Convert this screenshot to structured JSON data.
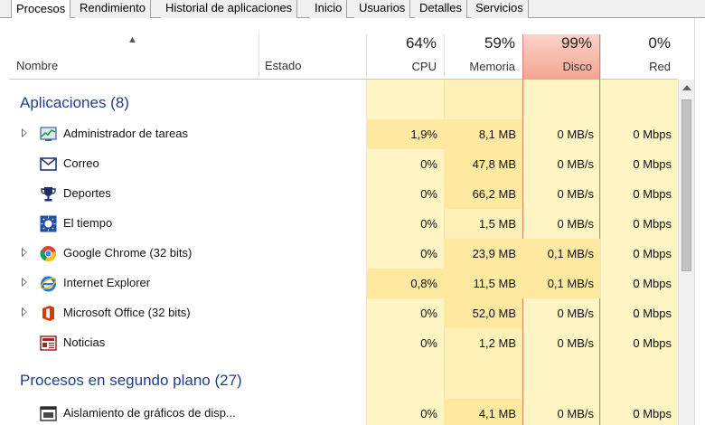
{
  "tabs": [
    "Procesos",
    "Rendimiento",
    "Historial de aplicaciones",
    "Inicio",
    "Usuarios",
    "Detalles",
    "Servicios"
  ],
  "header": {
    "name_label": "Nombre",
    "status_label": "Estado",
    "cpu": {
      "percent": "64%",
      "label": "CPU"
    },
    "memory": {
      "percent": "59%",
      "label": "Memoria"
    },
    "disk": {
      "percent": "99%",
      "label": "Disco"
    },
    "network": {
      "percent": "0%",
      "label": "Red"
    }
  },
  "colors": {
    "usage_light": "#fff4c4",
    "usage_medium": "#ffe9a1",
    "disk_highlight": "#f4a48f",
    "group_title": "#1f3f8a"
  },
  "groups": [
    {
      "title": "Aplicaciones (8)",
      "rows": [
        {
          "name": "Administrador de tareas",
          "icon": "task-manager-icon",
          "expandable": true,
          "cpu": "1,9%",
          "memory": "8,1 MB",
          "disk": "0 MB/s",
          "network": "0 Mbps"
        },
        {
          "name": "Correo",
          "icon": "mail-icon",
          "expandable": false,
          "cpu": "0%",
          "memory": "47,8 MB",
          "disk": "0 MB/s",
          "network": "0 Mbps"
        },
        {
          "name": "Deportes",
          "icon": "trophy-icon",
          "expandable": false,
          "cpu": "0%",
          "memory": "66,2 MB",
          "disk": "0 MB/s",
          "network": "0 Mbps"
        },
        {
          "name": "El tiempo",
          "icon": "weather-sun-icon",
          "expandable": false,
          "cpu": "0%",
          "memory": "1,5 MB",
          "disk": "0 MB/s",
          "network": "0 Mbps"
        },
        {
          "name": "Google Chrome (32 bits)",
          "icon": "chrome-icon",
          "expandable": true,
          "cpu": "0%",
          "memory": "23,9 MB",
          "disk": "0,1 MB/s",
          "network": "0 Mbps"
        },
        {
          "name": "Internet Explorer",
          "icon": "internet-explorer-icon",
          "expandable": true,
          "cpu": "0,8%",
          "memory": "11,5 MB",
          "disk": "0,1 MB/s",
          "network": "0 Mbps"
        },
        {
          "name": "Microsoft Office (32 bits)",
          "icon": "office-icon",
          "expandable": true,
          "cpu": "0%",
          "memory": "52,0 MB",
          "disk": "0 MB/s",
          "network": "0 Mbps"
        },
        {
          "name": "Noticias",
          "icon": "news-icon",
          "expandable": false,
          "cpu": "0%",
          "memory": "1,2 MB",
          "disk": "0 MB/s",
          "network": "0 Mbps"
        }
      ]
    },
    {
      "title": "Procesos en segundo plano (27)",
      "rows": [
        {
          "name": "Aislamiento de gráficos de disp...",
          "icon": "graphics-isolation-icon",
          "expandable": false,
          "cpu": "0%",
          "memory": "4,1 MB",
          "disk": "0 MB/s",
          "network": "0 Mbps"
        }
      ]
    }
  ]
}
